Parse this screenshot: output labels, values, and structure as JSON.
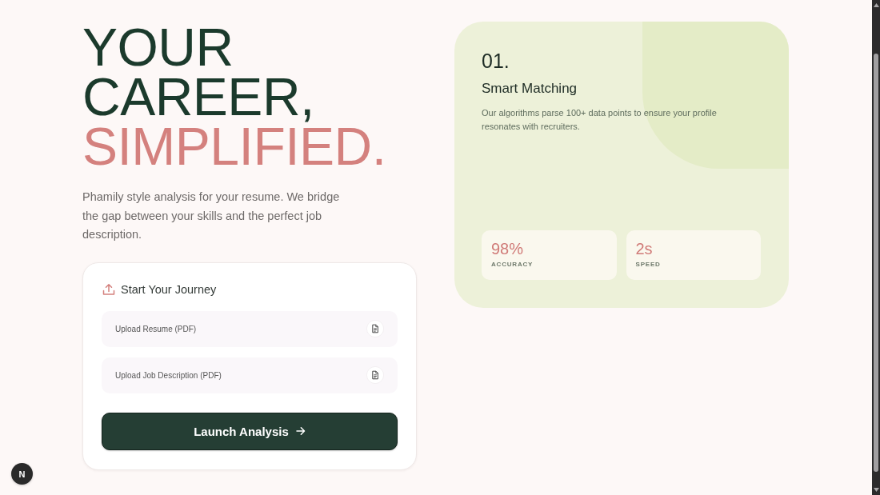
{
  "hero": {
    "title_lines": [
      {
        "text": "YOUR",
        "color": "#1b3a2c"
      },
      {
        "text": "CAREER,",
        "color": "#1b3a2c"
      },
      {
        "text": "SIMPLIFIED.",
        "color": "#d4817e"
      }
    ],
    "description": "Phamily style analysis for your resume. We bridge the gap between your skills and the perfect job description."
  },
  "upload_card": {
    "title": "Start Your Journey",
    "fields": [
      {
        "label": "Upload Resume (PDF)"
      },
      {
        "label": "Upload Job Description (PDF)"
      }
    ],
    "button": {
      "label": "Launch Analysis"
    }
  },
  "feature_card": {
    "number": "01.",
    "title": "Smart Matching",
    "description": "Our algorithms parse 100+ data points to ensure your profile resonates with recruiters.",
    "stats": [
      {
        "value": "98%",
        "label": "ACCURACY"
      },
      {
        "value": "2s",
        "label": "SPEED"
      }
    ]
  },
  "dev_badge": {
    "label": "N"
  }
}
